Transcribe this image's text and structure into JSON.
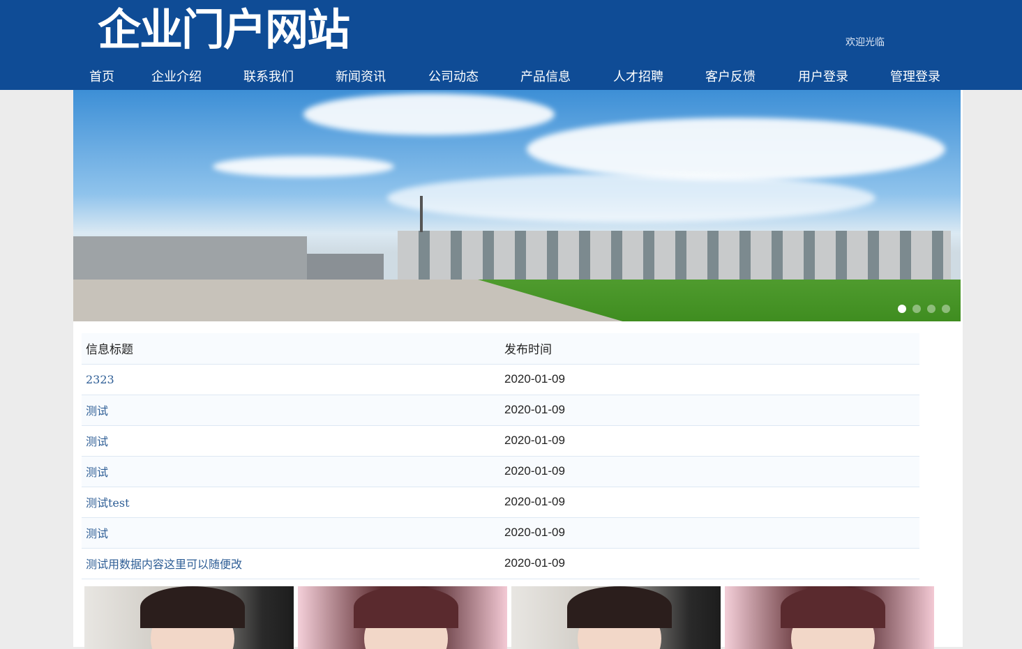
{
  "header": {
    "logo": "企业门户网站",
    "welcome": "欢迎光临"
  },
  "nav": [
    {
      "label": "首页"
    },
    {
      "label": "企业介绍"
    },
    {
      "label": "联系我们"
    },
    {
      "label": "新闻资讯"
    },
    {
      "label": "公司动态"
    },
    {
      "label": "产品信息"
    },
    {
      "label": "人才招聘"
    },
    {
      "label": "客户反馈"
    },
    {
      "label": "用户登录"
    },
    {
      "label": "管理登录"
    }
  ],
  "banner": {
    "slides": 4,
    "active": 1
  },
  "table": {
    "headers": [
      "信息标题",
      "发布时间"
    ],
    "rows": [
      {
        "title": "2323",
        "date": "2020-01-09"
      },
      {
        "title": "测试",
        "date": "2020-01-09"
      },
      {
        "title": "测试",
        "date": "2020-01-09"
      },
      {
        "title": "测试",
        "date": "2020-01-09"
      },
      {
        "title": "测试test",
        "date": "2020-01-09"
      },
      {
        "title": "测试",
        "date": "2020-01-09"
      },
      {
        "title": "测试用数据内容这里可以随便改",
        "date": "2020-01-09"
      }
    ]
  },
  "colors": {
    "header": "#0f4c96",
    "link": "#2d5d95"
  }
}
